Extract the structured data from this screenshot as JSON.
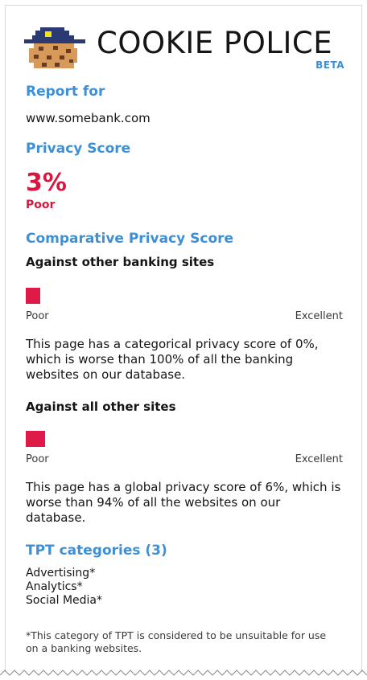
{
  "header": {
    "title": "COOKIE POLICE",
    "beta": "BETA"
  },
  "report": {
    "heading": "Report for",
    "url": "www.somebank.com"
  },
  "privacy": {
    "heading": "Privacy Score",
    "score": "3%",
    "rating": "Poor"
  },
  "comparative": {
    "heading": "Comparative Privacy Score",
    "banking": {
      "label": "Against other banking sites",
      "value_percent": 3,
      "scale_low": "Poor",
      "scale_high": "Excellent",
      "text": "This page has a categorical privacy score of 0%, which is worse than 100% of all the banking websites on our database."
    },
    "all": {
      "label": "Against all other sites",
      "value_percent": 6,
      "scale_low": "Poor",
      "scale_high": "Excellent",
      "text": "This page has a global privacy score of 6%, which is worse than 94% of all the websites on our database."
    }
  },
  "tpt": {
    "heading": "TPT categories (3)",
    "items": [
      "Advertising*",
      "Analytics*",
      "Social Media*"
    ],
    "footnote": "*This category of TPT is considered to be unsuitable for use on a banking websites."
  },
  "colors": {
    "accent": "#3d8fd6",
    "poor": "#d8163f",
    "bar": "#e01a48"
  },
  "icons": {
    "logo": "cookie-with-police-hat-icon"
  }
}
